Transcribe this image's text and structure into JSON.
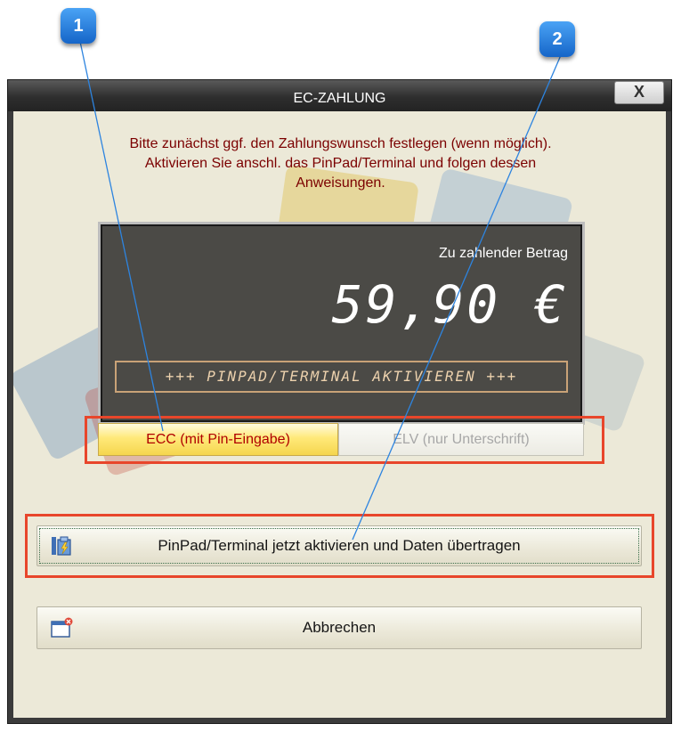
{
  "callouts": [
    "1",
    "2"
  ],
  "window": {
    "title": "EC-ZAHLUNG",
    "close_label": "X"
  },
  "instructions": {
    "lines": [
      "Bitte zunächst ggf. den Zahlungswunsch festlegen (wenn möglich).",
      "Aktivieren Sie anschl. das PinPad/Terminal und folgen dessen",
      "Anweisungen."
    ]
  },
  "display": {
    "amount_label": "Zu zahlender Betrag",
    "amount_value": "59,90 €",
    "status": "+++ PINPAD/TERMINAL AKTIVIEREN +++"
  },
  "payment_modes": {
    "ecc_label": "ECC (mit Pin-Eingabe)",
    "elv_label": "ELV (nur Unterschrift)",
    "selected": "ECC (mit Pin-Eingabe)"
  },
  "actions": {
    "activate_label": "PinPad/Terminal jetzt aktivieren und Daten übertragen",
    "activate_icon": "terminal-icon",
    "cancel_label": "Abbrechen",
    "cancel_icon": "window-close-icon"
  },
  "colors": {
    "instruction_text": "#7b0000",
    "highlight_frame": "#e8462b",
    "callout_badge": "#1e7be0",
    "selected_mode_text": "#b00000"
  }
}
